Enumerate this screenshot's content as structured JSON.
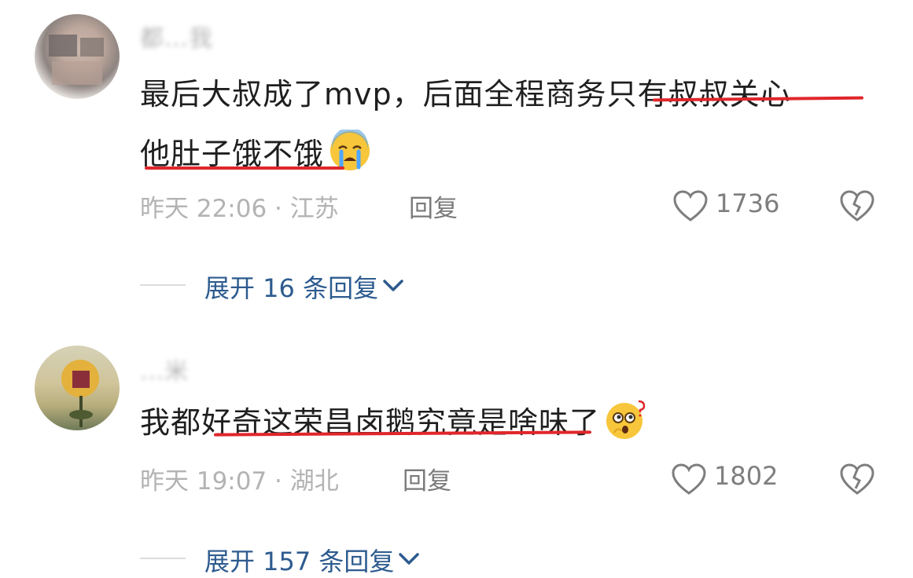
{
  "comments": [
    {
      "username": "都…我",
      "text_line1": "最后大叔成了mvp，后面全程商务只有叔叔关心",
      "text_line2": "他肚子饿不饿",
      "emoji": "crying-face",
      "time": "昨天 22:06 · 江苏",
      "reply_label": "回复",
      "likes": "1736",
      "expand_label": "展开 16 条回复"
    },
    {
      "username": "…米",
      "text_line1": "我都好奇这荣昌卤鹅究竟是啥味了",
      "emoji": "thinking-question-face",
      "time": "昨天 19:07 · 湖北",
      "reply_label": "回复",
      "likes": "1802",
      "expand_label": "展开 157 条回复"
    }
  ],
  "colors": {
    "underline": "#e0262b",
    "expand_link": "#2d5b8f",
    "meta_text": "#b3b3b3"
  }
}
